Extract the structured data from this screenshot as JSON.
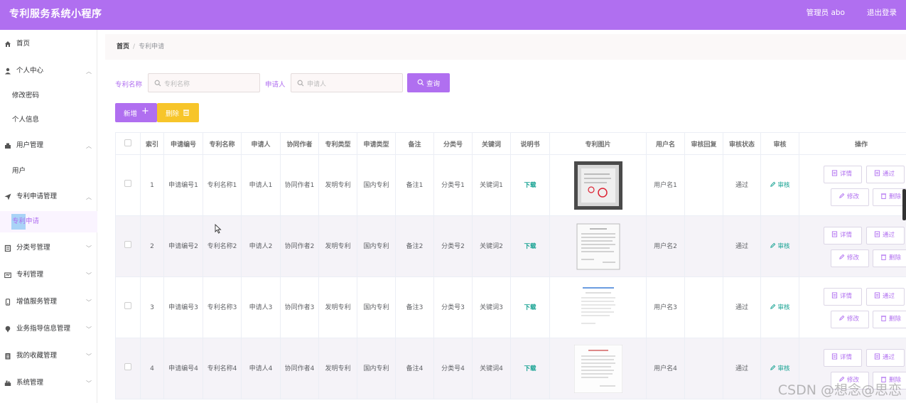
{
  "header": {
    "title": "专利服务系统小程序",
    "admin_label": "管理员 abo",
    "logout": "退出登录",
    "bg_color": "#b06ff0"
  },
  "sidebar": {
    "items": [
      {
        "label": "首页",
        "icon": "home-icon"
      },
      {
        "label": "个人中心",
        "icon": "user-icon",
        "expanded": true,
        "children": [
          {
            "label": "修改密码"
          },
          {
            "label": "个人信息"
          }
        ]
      },
      {
        "label": "用户管理",
        "icon": "users-icon",
        "expanded": true,
        "children": [
          {
            "label": "用户"
          }
        ]
      },
      {
        "label": "专利申请管理",
        "icon": "send-icon",
        "expanded": true,
        "children": [
          {
            "label": "专利申请",
            "active": true
          }
        ]
      },
      {
        "label": "分类号管理",
        "icon": "category-icon"
      },
      {
        "label": "专利管理",
        "icon": "patent-icon"
      },
      {
        "label": "增值服务管理",
        "icon": "service-icon"
      },
      {
        "label": "业务指导信息管理",
        "icon": "pin-icon"
      },
      {
        "label": "我的收藏管理",
        "icon": "collection-icon"
      },
      {
        "label": "系统管理",
        "icon": "system-icon"
      }
    ]
  },
  "breadcrumb": {
    "home": "首页",
    "separator": "/",
    "current": "专利申请"
  },
  "search": {
    "name_label": "专利名称",
    "name_placeholder": "专利名称",
    "applicant_label": "申请人",
    "applicant_placeholder": "申请人",
    "button": "查询"
  },
  "actions": {
    "add": "新增",
    "delete": "删除"
  },
  "table": {
    "columns": [
      "索引",
      "申请编号",
      "专利名称",
      "申请人",
      "协同作者",
      "专利类型",
      "申请类型",
      "备注",
      "分类号",
      "关键词",
      "说明书",
      "专利图片",
      "用户名",
      "审核回复",
      "审核状态",
      "审核",
      "操作"
    ],
    "rows": [
      {
        "index": "1",
        "app_no": "申请编号1",
        "name": "专利名称1",
        "applicant": "申请人1",
        "coauthor": "协同作者1",
        "patent_type": "发明专利",
        "apply_type": "国内专利",
        "remark": "备注1",
        "class_no": "分类号1",
        "keyword": "关键词1",
        "manual": "下载",
        "username": "用户名1",
        "reply": "",
        "status": "通过",
        "review": "审核"
      },
      {
        "index": "2",
        "app_no": "申请编号2",
        "name": "专利名称2",
        "applicant": "申请人2",
        "coauthor": "协同作者2",
        "patent_type": "发明专利",
        "apply_type": "国内专利",
        "remark": "备注2",
        "class_no": "分类号2",
        "keyword": "关键词2",
        "manual": "下载",
        "username": "用户名2",
        "reply": "",
        "status": "通过",
        "review": "审核"
      },
      {
        "index": "3",
        "app_no": "申请编号3",
        "name": "专利名称3",
        "applicant": "申请人3",
        "coauthor": "协同作者3",
        "patent_type": "发明专利",
        "apply_type": "国内专利",
        "remark": "备注3",
        "class_no": "分类号3",
        "keyword": "关键词3",
        "manual": "下载",
        "username": "用户名3",
        "reply": "",
        "status": "通过",
        "review": "审核"
      },
      {
        "index": "4",
        "app_no": "申请编号4",
        "name": "专利名称4",
        "applicant": "申请人4",
        "coauthor": "协同作者4",
        "patent_type": "发明专利",
        "apply_type": "国内专利",
        "remark": "备注4",
        "class_no": "分类号4",
        "keyword": "关键词4",
        "manual": "下载",
        "username": "用户名4",
        "reply": "",
        "status": "通过",
        "review": "审核"
      }
    ],
    "op_labels": {
      "detail": "详情",
      "pass": "通过",
      "edit": "修改",
      "delete": "删除"
    }
  },
  "watermark": "CSDN @想念@思恋"
}
